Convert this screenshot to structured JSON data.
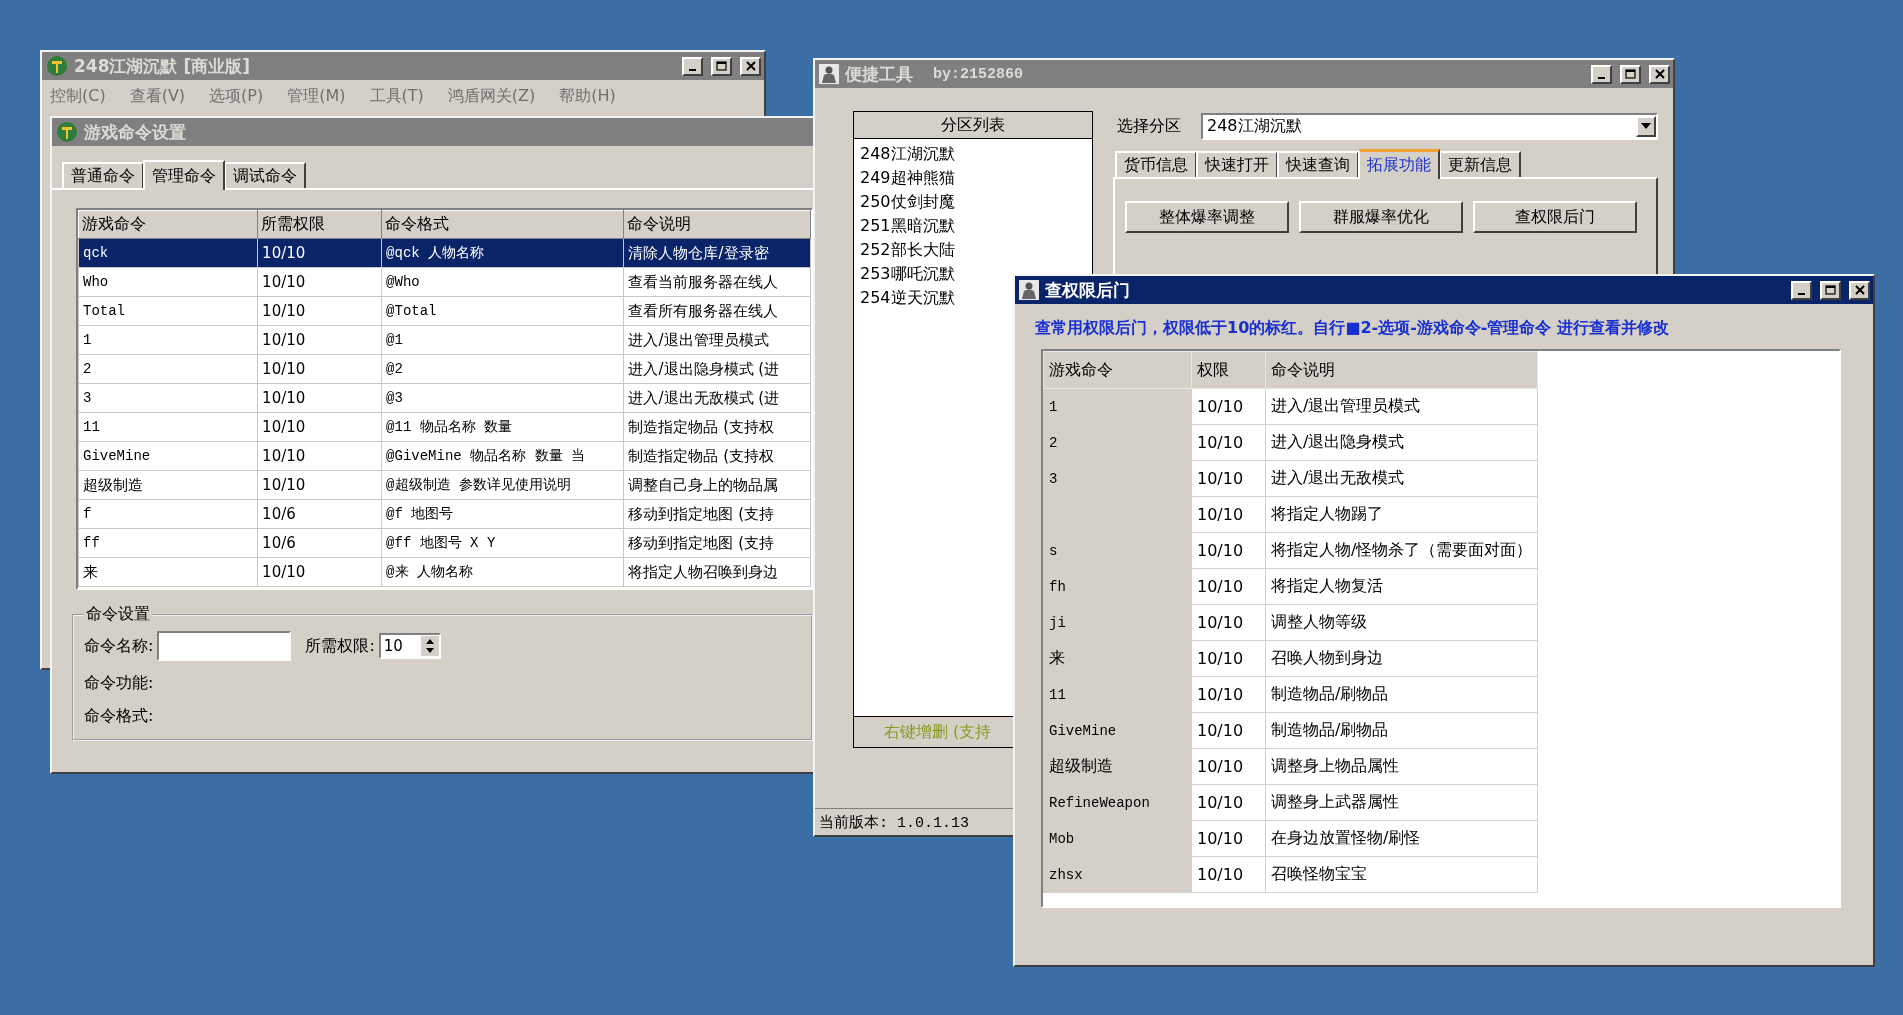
{
  "main_window": {
    "title": "248江湖沉默 [商业版]",
    "active": false,
    "menu": [
      "控制(C)",
      "查看(V)",
      "选项(P)",
      "管理(M)",
      "工具(T)",
      "鸿盾网关(Z)",
      "帮助(H)"
    ]
  },
  "command_window": {
    "title": "游戏命令设置",
    "active": false,
    "tabs": [
      {
        "label": "普通命令",
        "selected": false
      },
      {
        "label": "管理命令",
        "selected": true
      },
      {
        "label": "调试命令",
        "selected": false
      }
    ],
    "table": {
      "columns": [
        "游戏命令",
        "所需权限",
        "命令格式",
        "命令说明"
      ],
      "rows": [
        {
          "cells": [
            "qck",
            "10/10",
            "@qck 人物名称",
            "清除人物仓库/登录密"
          ],
          "selected": true
        },
        {
          "cells": [
            "Who",
            "10/10",
            "@Who",
            "查看当前服务器在线人"
          ],
          "selected": false
        },
        {
          "cells": [
            "Total",
            "10/10",
            "@Total",
            "查看所有服务器在线人"
          ],
          "selected": false
        },
        {
          "cells": [
            "1",
            "10/10",
            "@1",
            "进入/退出管理员模式"
          ],
          "selected": false
        },
        {
          "cells": [
            "2",
            "10/10",
            "@2",
            "进入/退出隐身模式 (进"
          ],
          "selected": false
        },
        {
          "cells": [
            "3",
            "10/10",
            "@3",
            "进入/退出无敌模式 (进"
          ],
          "selected": false
        },
        {
          "cells": [
            "11",
            "10/10",
            "@11 物品名称 数量",
            "制造指定物品 (支持权"
          ],
          "selected": false
        },
        {
          "cells": [
            "GiveMine",
            "10/10",
            "@GiveMine 物品名称 数量 当",
            "制造指定物品 (支持权"
          ],
          "selected": false
        },
        {
          "cells": [
            "超级制造",
            "10/10",
            "@超级制造 参数详见使用说明",
            "调整自己身上的物品属"
          ],
          "selected": false
        },
        {
          "cells": [
            "f",
            "10/6",
            "@f 地图号",
            "移动到指定地图 (支持"
          ],
          "selected": false
        },
        {
          "cells": [
            "ff",
            "10/6",
            "@ff 地图号 X Y",
            "移动到指定地图 (支持"
          ],
          "selected": false
        },
        {
          "cells": [
            "来",
            "10/10",
            "@来 人物名称",
            "将指定人物召唤到身边"
          ],
          "selected": false
        }
      ]
    },
    "settings": {
      "title": "命令设置",
      "name_label": "命令名称:",
      "permission_label": "所需权限:",
      "permission_value": "10",
      "function_label": "命令功能:",
      "format_label": "命令格式:"
    }
  },
  "tool_window": {
    "title": "便捷工具",
    "author": "by:2152860",
    "active": false,
    "partition_list": {
      "header": "分区列表",
      "items": [
        "248江湖沉默",
        "249超神熊猫",
        "250仗剑封魔",
        "251黑暗沉默",
        "252部长大陆",
        "253哪吒沉默",
        "254逆天沉默"
      ],
      "footer": "右键增删 (支持"
    },
    "select_label": "选择分区",
    "select_value": "248江湖沉默",
    "tabs": [
      {
        "label": "货币信息",
        "selected": false
      },
      {
        "label": "快速打开",
        "selected": false
      },
      {
        "label": "快速查询",
        "selected": false
      },
      {
        "label": "拓展功能",
        "selected": true
      },
      {
        "label": "更新信息",
        "selected": false
      }
    ],
    "buttons": [
      "整体爆率调整",
      "群服爆率优化",
      "查权限后门"
    ],
    "version": "当前版本: 1.0.1.13"
  },
  "backdoor_window": {
    "title": "查权限后门",
    "active": true,
    "note": "查常用权限后门，权限低于10的标红。自行■2-选项-游戏命令-管理命令 进行查看并修改",
    "table": {
      "columns": [
        "游戏命令",
        "权限",
        "命令说明"
      ],
      "rows": [
        {
          "command": "1",
          "permission": "10/10",
          "description": "进入/退出管理员模式"
        },
        {
          "command": "2",
          "permission": "10/10",
          "description": "进入/退出隐身模式"
        },
        {
          "command": "3",
          "permission": "10/10",
          "description": "进入/退出无敌模式"
        },
        {
          "permission": "10/10",
          "description": "将指定人物踢了"
        },
        {
          "command": "s",
          "permission": "10/10",
          "description": "将指定人物/怪物杀了（需要面对面）"
        },
        {
          "command": "fh",
          "permission": "10/10",
          "description": "将指定人物复活"
        },
        {
          "command": "ji",
          "permission": "10/10",
          "description": "调整人物等级"
        },
        {
          "command": "来",
          "permission": "10/10",
          "description": "召唤人物到身边"
        },
        {
          "command": "11",
          "permission": "10/10",
          "description": "制造物品/刷物品"
        },
        {
          "command": "GiveMine",
          "permission": "10/10",
          "description": "制造物品/刷物品"
        },
        {
          "command": "超级制造",
          "permission": "10/10",
          "description": "调整身上物品属性"
        },
        {
          "command": "RefineWeapon",
          "permission": "10/10",
          "description": "调整身上武器属性"
        },
        {
          "command": "Mob",
          "permission": "10/10",
          "description": "在身边放置怪物/刷怪"
        },
        {
          "command": "zhsx",
          "permission": "10/10",
          "description": "召唤怪物宝宝"
        }
      ]
    }
  }
}
